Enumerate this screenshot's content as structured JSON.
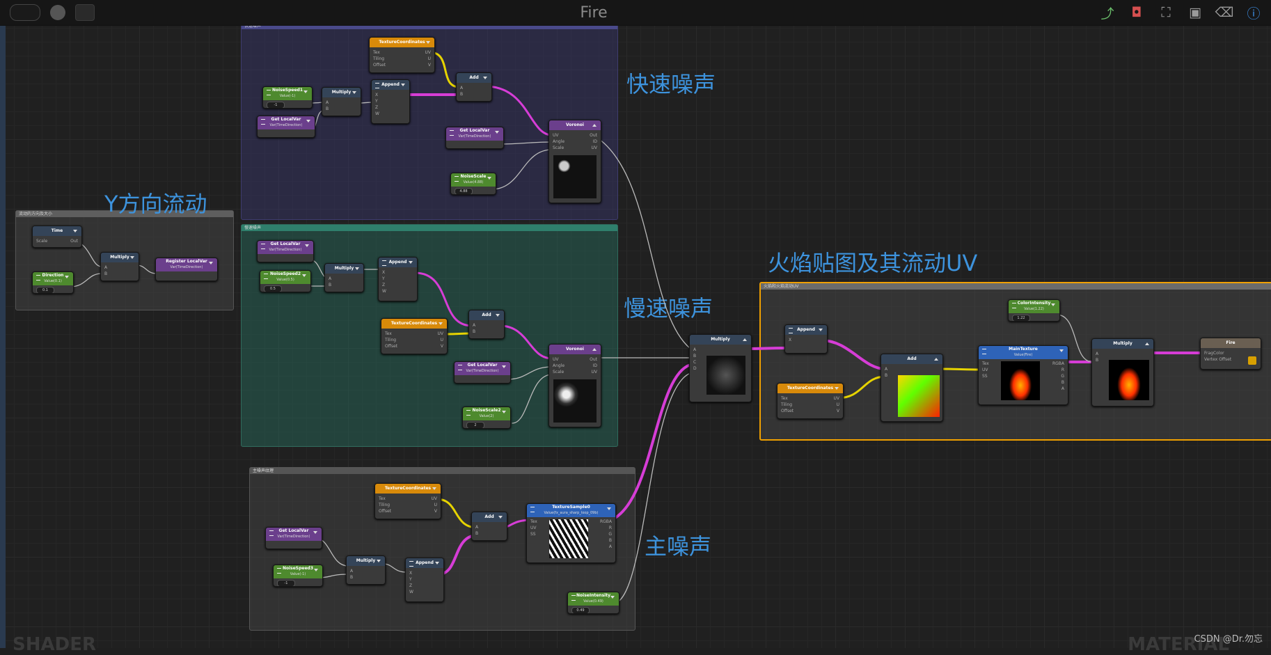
{
  "window": {
    "title": "Fire"
  },
  "toolbar_right_icons": [
    "share-icon",
    "camera-icon",
    "fit-view-icon",
    "focus-icon",
    "clean-icon",
    "info-icon"
  ],
  "notes": {
    "fast_noise": "快速噪声",
    "y_flow": "Y方向流动",
    "slow_noise": "慢速噪声",
    "fire_tex": "火焰贴图及其流动UV",
    "main_noise": "主噪声"
  },
  "groups": {
    "fast": "快速噪声",
    "flow": "流动的方向及大小",
    "slow": "慢速噪声",
    "main": "主噪声纹理",
    "fire": "火焰和火焰流动UV"
  },
  "nodes": {
    "time": {
      "title": "Time",
      "ports": [
        "Scale",
        "Out"
      ]
    },
    "direction": {
      "title": "Direction",
      "sub": "Value(0.1)",
      "field": "0.1"
    },
    "flow_mul": {
      "title": "Multiply",
      "ports": [
        "A",
        "B"
      ]
    },
    "register": {
      "title": "Register LocalVar",
      "sub": "Var(TimeDirection)"
    },
    "fast_tc": {
      "title": "TextureCoordinates",
      "ports": [
        "Tex",
        "UV",
        "Tiling",
        "U",
        "Offset",
        "V"
      ]
    },
    "fast_speed": {
      "title": "NoiseSpeed1",
      "sub": "Value(-1)",
      "field": "-1"
    },
    "fast_var": {
      "title": "Get LocalVar",
      "sub": "Var(TimeDirection)"
    },
    "fast_mul": {
      "title": "Multiply",
      "ports": [
        "A",
        "B"
      ]
    },
    "fast_app": {
      "title": "Append",
      "ports": [
        "X",
        "Y",
        "Z",
        "W"
      ]
    },
    "fast_add": {
      "title": "Add",
      "ports": [
        "A",
        "B"
      ]
    },
    "fast_var2": {
      "title": "Get LocalVar",
      "sub": "Var(TimeDirection)"
    },
    "fast_scale": {
      "title": "NoiseScale",
      "sub": "Value(4.88)",
      "field": "4.88"
    },
    "fast_vor": {
      "title": "Voronoi",
      "ports": [
        "UV",
        "Out",
        "Angle",
        "ID",
        "Scale",
        "UV"
      ]
    },
    "slow_var": {
      "title": "Get LocalVar",
      "sub": "Var(TimeDirection)"
    },
    "slow_speed": {
      "title": "NoiseSpeed2",
      "sub": "Value(0.5)",
      "field": "0.5"
    },
    "slow_mul": {
      "title": "Multiply",
      "ports": [
        "A",
        "B"
      ]
    },
    "slow_app": {
      "title": "Append",
      "ports": [
        "X",
        "Y",
        "Z",
        "W"
      ]
    },
    "slow_tc": {
      "title": "TextureCoordinates",
      "ports": [
        "Tex",
        "UV",
        "Tiling",
        "U",
        "Offset",
        "V"
      ]
    },
    "slow_add": {
      "title": "Add",
      "ports": [
        "A",
        "B"
      ]
    },
    "slow_var2": {
      "title": "Get LocalVar",
      "sub": "Var(TimeDirection)"
    },
    "slow_scale": {
      "title": "NoiseScale2",
      "sub": "Value(2)",
      "field": "2"
    },
    "slow_vor": {
      "title": "Voronoi",
      "ports": [
        "UV",
        "Out",
        "Angle",
        "ID",
        "Scale",
        "UV"
      ]
    },
    "main_tc": {
      "title": "TextureCoordinates",
      "ports": [
        "Tex",
        "UV",
        "Tiling",
        "U",
        "Offset",
        "V"
      ]
    },
    "main_var": {
      "title": "Get LocalVar",
      "sub": "Var(TimeDirection)"
    },
    "main_speed": {
      "title": "NoiseSpeed3",
      "sub": "Value(-1)",
      "field": "-1"
    },
    "main_mul": {
      "title": "Multiply",
      "ports": [
        "A",
        "B"
      ]
    },
    "main_app": {
      "title": "Append",
      "ports": [
        "X",
        "Y",
        "Z",
        "W"
      ]
    },
    "main_add": {
      "title": "Add",
      "ports": [
        "A",
        "B"
      ]
    },
    "main_tex": {
      "title": "TextureSample0",
      "sub": "Value(fx_aura_sharp_loop_09b)",
      "ports": [
        "Tex",
        "RGBA",
        "UV",
        "R",
        "SS",
        "G",
        "B",
        "A"
      ]
    },
    "main_int": {
      "title": "NoiseIntensity",
      "sub": "Value(0.49)",
      "field": "0.49"
    },
    "big_mul": {
      "title": "Multiply",
      "ports": [
        "A",
        "B",
        "C",
        "D"
      ]
    },
    "fire_app": {
      "title": "Append",
      "ports": [
        "X",
        "Y",
        "Z",
        "W"
      ]
    },
    "fire_tc": {
      "title": "TextureCoordinates",
      "ports": [
        "Tex",
        "UV",
        "Tiling",
        "U",
        "Offset",
        "V"
      ]
    },
    "fire_add": {
      "title": "Add",
      "ports": [
        "A",
        "B"
      ]
    },
    "fire_tex": {
      "title": "MainTexture",
      "sub": "Value(Fire)",
      "ports": [
        "Tex",
        "RGBA",
        "UV",
        "R",
        "SS",
        "G",
        "B",
        "A"
      ]
    },
    "color_int": {
      "title": "ColorIntensity",
      "sub": "Value(1.22)",
      "field": "1.22"
    },
    "fire_mul": {
      "title": "Multiply",
      "ports": [
        "A",
        "B"
      ]
    },
    "output": {
      "title": "Fire",
      "ports": [
        "FragColor",
        "Vertex Offset"
      ]
    }
  },
  "bottom": {
    "shader": "SHADER",
    "material": "MATERIAL",
    "watermark": "CSDN @Dr.勿忘"
  }
}
